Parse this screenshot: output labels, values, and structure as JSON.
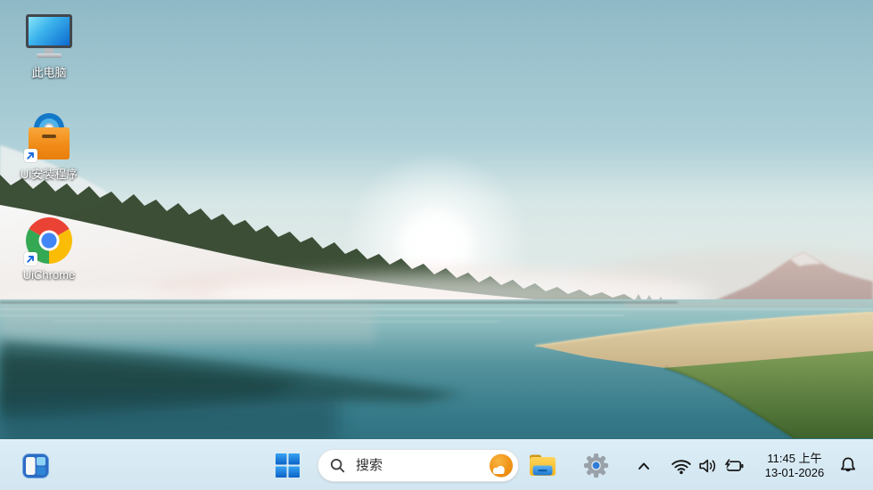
{
  "desktop": {
    "icons": [
      {
        "name": "this-pc",
        "label": "此电脑"
      },
      {
        "name": "ui-installer",
        "label": "Ui安装程序"
      },
      {
        "name": "ui-chrome",
        "label": "UiChrome"
      }
    ]
  },
  "taskbar": {
    "search": {
      "placeholder": "搜索"
    },
    "clock": {
      "time": "11:45 上午",
      "date": "13-01-2026"
    },
    "icons": [
      "widgets-icon",
      "start-icon",
      "search-icon",
      "weather-icon",
      "file-explorer-icon",
      "settings-gear-icon",
      "chevron-up-icon",
      "wifi-icon",
      "volume-icon",
      "battery-charging-icon",
      "notification-bell-icon"
    ]
  },
  "colors": {
    "taskbar_bg": "#d6e9f3",
    "start_blue": "#0e6fd0",
    "sky_top": "#90bac6",
    "water_deep": "#2e6f7c",
    "grass_tan": "#d8c69c",
    "grass_green": "#5d8140",
    "installer_orange": "#f08a15",
    "search_pill_bg": "#ffffff"
  }
}
